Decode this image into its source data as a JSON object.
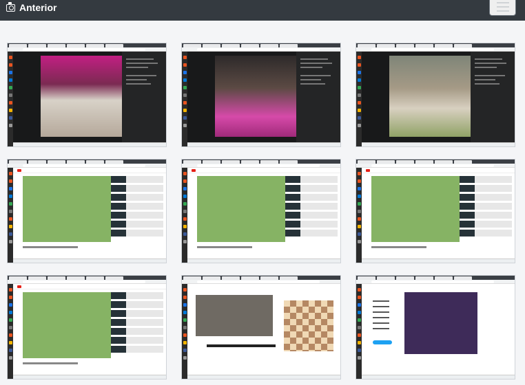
{
  "header": {
    "title": "Anterior",
    "title_icon": "camera-icon",
    "menu_icon": "hamburger-icon"
  },
  "thumbnails": [
    {
      "kind": "facebook",
      "variant": 1
    },
    {
      "kind": "facebook",
      "variant": 2
    },
    {
      "kind": "facebook",
      "variant": 3
    },
    {
      "kind": "youtube",
      "variant": 1
    },
    {
      "kind": "youtube",
      "variant": 2
    },
    {
      "kind": "youtube",
      "variant": 3
    },
    {
      "kind": "youtube",
      "variant": 4
    },
    {
      "kind": "news-chess",
      "variant": 1
    },
    {
      "kind": "twitter",
      "variant": 1
    }
  ],
  "colors": {
    "navbar": "#343a40",
    "background": "#f4f5f7"
  }
}
